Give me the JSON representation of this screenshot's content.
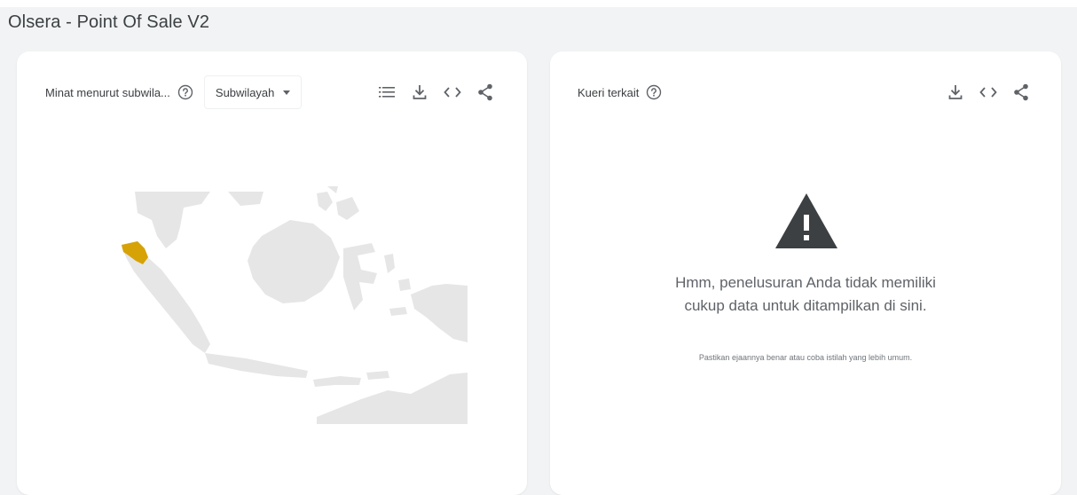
{
  "page": {
    "title": "Olsera - Point Of Sale V2"
  },
  "left_card": {
    "title": "Minat menurut subwila...",
    "dropdown": {
      "selected": "Subwilayah"
    },
    "icons": [
      "help-icon",
      "list-icon",
      "download-icon",
      "embed-code-icon",
      "share-icon"
    ],
    "map": {
      "region": "Indonesia",
      "highlighted_region_color": "#d6a206",
      "base_color": "#e6e6e6"
    }
  },
  "right_card": {
    "title": "Kueri terkait",
    "icons": [
      "help-icon",
      "download-icon",
      "embed-code-icon",
      "share-icon"
    ],
    "empty_state": {
      "message": "Hmm, penelusuran Anda tidak memiliki cukup data untuk ditampilkan di sini.",
      "hint": "Pastikan ejaannya benar atau coba istilah yang lebih umum."
    }
  },
  "colors": {
    "background": "#f1f3f4",
    "card": "#ffffff",
    "icon": "#5f6368",
    "warning": "#3c4043"
  }
}
